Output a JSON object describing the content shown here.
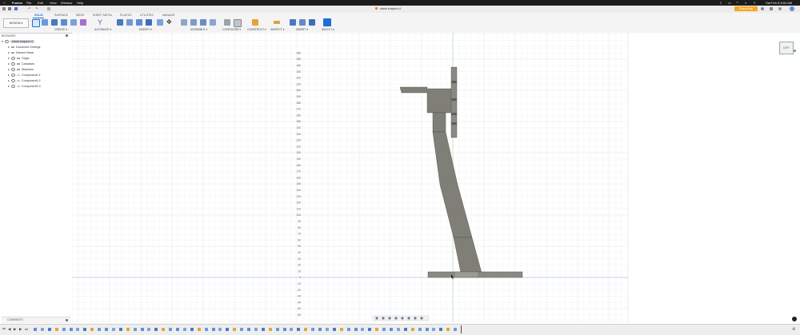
{
  "menubar": {
    "items": [
      "Fusion",
      "File",
      "Edit",
      "View",
      "Window",
      "Help"
    ],
    "clock": "Sat Feb 8  8:54 AM"
  },
  "titlebar": {
    "doc_title": "stand shaped v1",
    "trial_badge": "Extend trial"
  },
  "toolbar": {
    "workspace": "DESIGN ▾",
    "tabs": [
      "SOLID",
      "SURFACE",
      "MESH",
      "SHEET METAL",
      "PLASTIC",
      "UTILITIES",
      "MANAGE"
    ],
    "groups": [
      "CREATE ▾",
      "AUTOMATE ▾",
      "MODIFY ▾",
      "ASSEMBLE ▾",
      "CONFIGURE ▾",
      "CONSTRUCT ▾",
      "INSPECT ▾",
      "INSERT ▾",
      "SELECT ▾"
    ]
  },
  "browser": {
    "header": "BROWSER",
    "root": "stand shaped v1",
    "items": [
      "Document Settings",
      "Named Views",
      "Origin",
      "Canvases",
      "Sketches",
      "Component1:1",
      "Component1:2",
      "Component1:3"
    ]
  },
  "comments": {
    "label": "COMMENTS"
  },
  "viewcube": {
    "face": "LEFT"
  },
  "ruler": {
    "labels": [
      "360",
      "350",
      "340",
      "330",
      "320",
      "310",
      "300",
      "290",
      "280",
      "270",
      "260",
      "250",
      "240",
      "230",
      "220",
      "210",
      "200",
      "190",
      "180",
      "170",
      "160",
      "150",
      "140",
      "130",
      "120",
      "110",
      "100",
      "90",
      "80",
      "70",
      "60",
      "50",
      "40",
      "30",
      "20",
      "10",
      "0",
      "-10",
      "-20",
      "-30",
      "-40",
      "-50",
      "-60",
      "-70"
    ]
  },
  "colors": {
    "accent": "#1d6fd6",
    "trial": "#f5a623",
    "body_fill": "#7f7f78",
    "body_dark": "#5e5e58",
    "grid_minor": "#eef0f2",
    "grid_major": "#dcdfe3",
    "x_axis": "#9bb0e8",
    "y_axis": "#a6dca6"
  },
  "icons": [
    "apple-icon",
    "search-icon",
    "wifi-icon",
    "battery-icon",
    "control-center-icon",
    "grid-icon",
    "save-icon",
    "undo-icon",
    "redo-icon",
    "home-icon",
    "new-component-icon",
    "sketch-icon",
    "extrude-icon",
    "revolve-icon",
    "sweep-icon",
    "automate-icon",
    "press-pull-icon",
    "fillet-icon",
    "chamfer-icon",
    "shell-icon",
    "move-icon",
    "joint-icon",
    "as-built-joint-icon",
    "configure-icon",
    "construct-plane-icon",
    "measure-icon",
    "insert-icon",
    "select-icon",
    "orbit-icon",
    "pan-icon",
    "zoom-icon",
    "display-settings-icon",
    "grid-settings-icon",
    "settings-icon",
    "play-icon",
    "step-back-icon",
    "step-forward-icon",
    "end-icon"
  ]
}
